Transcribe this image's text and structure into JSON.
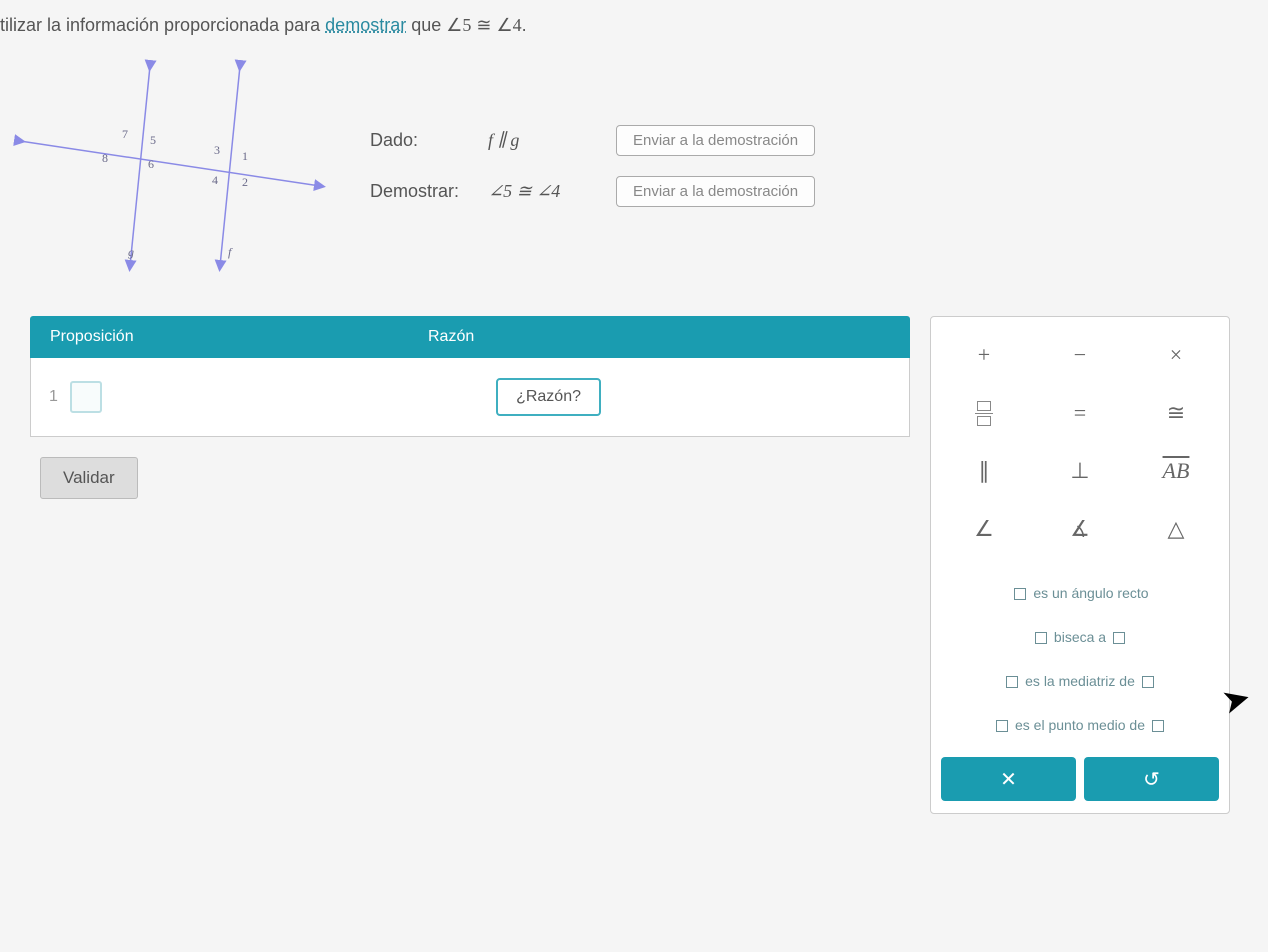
{
  "prompt": {
    "prefix": "tilizar la información proporcionada para ",
    "link": "demostrar",
    "mid": " que ",
    "expr1": "∠5",
    "rel": " ≅ ",
    "expr2": "∠4",
    "suffix": "."
  },
  "diagram": {
    "labels": {
      "a1": "1",
      "a2": "2",
      "a3": "3",
      "a4": "4",
      "a5": "5",
      "a6": "6",
      "a7": "7",
      "a8": "8",
      "line_f": "f",
      "line_g": "g"
    }
  },
  "given": {
    "dado_label": "Dado:",
    "dado_value": "f ∥ g",
    "demostrar_label": "Demostrar:",
    "demostrar_value": "∠5 ≅ ∠4",
    "send": "Enviar a la demostración"
  },
  "proof": {
    "col_prop": "Proposición",
    "col_reason": "Razón",
    "step1_num": "1",
    "reason_btn": "¿Razón?",
    "validate": "Validar"
  },
  "toolbox": {
    "symbols": {
      "plus": "+",
      "minus": "−",
      "times": "×",
      "frac": "▭⁄▭",
      "equals": "=",
      "congruent": "≅",
      "parallel": "∥",
      "perp": "⊥",
      "segment": "AB",
      "angle": "∠",
      "measured_angle": "∡",
      "triangle": "△"
    },
    "phrases": {
      "right_angle": "es un ángulo recto",
      "bisects": "biseca a",
      "perp_bisector": "es la mediatriz de",
      "midpoint": "es el punto medio de"
    },
    "actions": {
      "clear": "✕",
      "undo": "↺"
    }
  }
}
